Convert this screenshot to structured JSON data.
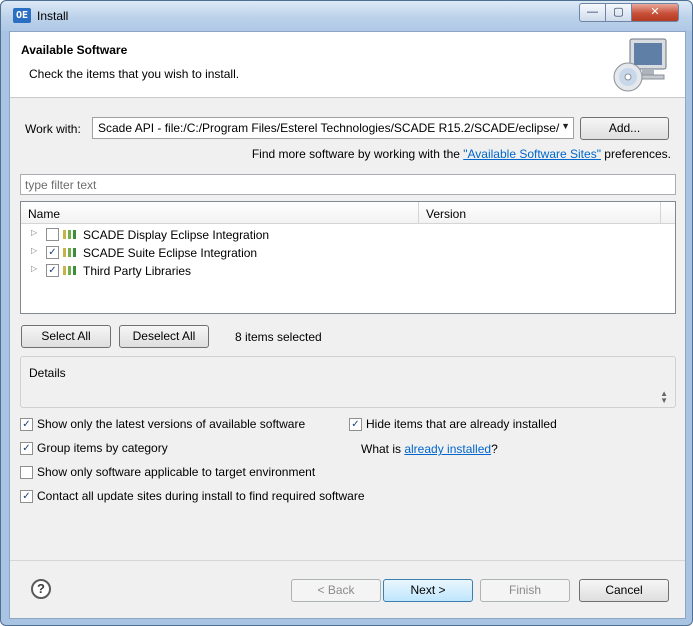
{
  "window": {
    "icon_text": "OE",
    "title": "Install",
    "controls": {
      "minimize": "—",
      "maximize": "▢",
      "close": "✕"
    }
  },
  "banner": {
    "title": "Available Software",
    "description": "Check the items that you wish to install."
  },
  "work_with": {
    "label": "Work with:",
    "value": "Scade API - file:/C:/Program Files/Esterel Technologies/SCADE R15.2/SCADE/eclipse/",
    "add_button": "Add...",
    "more_prefix": "Find more software by working with the ",
    "more_link": "\"Available Software Sites\"",
    "more_suffix": " preferences."
  },
  "filter": {
    "placeholder": "type filter text"
  },
  "tree": {
    "columns": {
      "name": "Name",
      "version": "Version"
    },
    "items": [
      {
        "label": "SCADE Display Eclipse Integration",
        "checked": false,
        "check": ""
      },
      {
        "label": "SCADE Suite Eclipse Integration",
        "checked": true,
        "check": "✓"
      },
      {
        "label": "Third Party Libraries",
        "checked": true,
        "check": "✓"
      }
    ],
    "expander": "▷"
  },
  "selection": {
    "select_all": "Select All",
    "deselect_all": "Deselect All",
    "count_text": "8 items selected"
  },
  "details": {
    "title": "Details",
    "scroll_up": "▲",
    "scroll_down": "▼"
  },
  "options": {
    "latest_versions": {
      "label": "Show only the latest versions of available software",
      "checked": true,
      "check": "✓"
    },
    "group_by_category": {
      "label": "Group items by category",
      "checked": true,
      "check": "✓"
    },
    "target_env": {
      "label": "Show only software applicable to target environment",
      "checked": false,
      "check": ""
    },
    "contact_sites": {
      "label": "Contact all update sites during install to find required software",
      "checked": true,
      "check": "✓"
    },
    "hide_installed": {
      "label": "Hide items that are already installed",
      "checked": true,
      "check": "✓"
    },
    "what_is_prefix": "What is ",
    "what_is_link": "already installed",
    "what_is_suffix": "?"
  },
  "footer": {
    "help": "?",
    "back": "< Back",
    "next": "Next >",
    "finish": "Finish",
    "cancel": "Cancel"
  },
  "colors": {
    "accent": "#0066cc",
    "title_bar": "#bcd2ea",
    "dialog_bg": "#f0f0f0"
  }
}
